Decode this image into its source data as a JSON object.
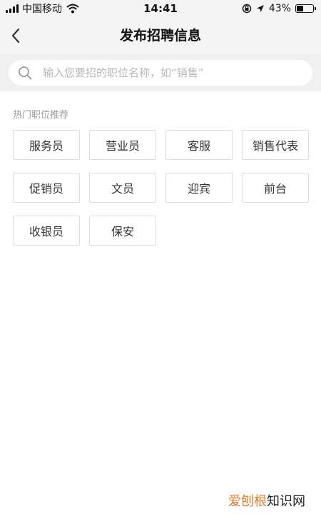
{
  "status_bar": {
    "carrier": "中国移动",
    "time": "14:41",
    "battery_percent": "43%",
    "battery_level": 0.43,
    "icons": [
      "signal-icon",
      "wifi-icon",
      "rotation-lock-icon",
      "location-arrow-icon",
      "battery-icon"
    ]
  },
  "nav": {
    "title": "发布招聘信息",
    "back_icon": "chevron-left-icon"
  },
  "search": {
    "placeholder": "输入您要招的职位名称，如“销售”",
    "value": "",
    "icon": "search-icon"
  },
  "hot_jobs": {
    "title": "热门职位推荐",
    "items": [
      "服务员",
      "营业员",
      "客服",
      "销售代表",
      "促销员",
      "文员",
      "迎宾",
      "前台",
      "收银员",
      "保安"
    ]
  },
  "watermark": {
    "part1": "爱刨根",
    "part2": "知识网"
  },
  "colors": {
    "header_bg": "#f4f4f4",
    "search_band_bg": "#f0f0f0",
    "tag_border": "#dedede",
    "watermark_accent": "#e07b2a"
  }
}
